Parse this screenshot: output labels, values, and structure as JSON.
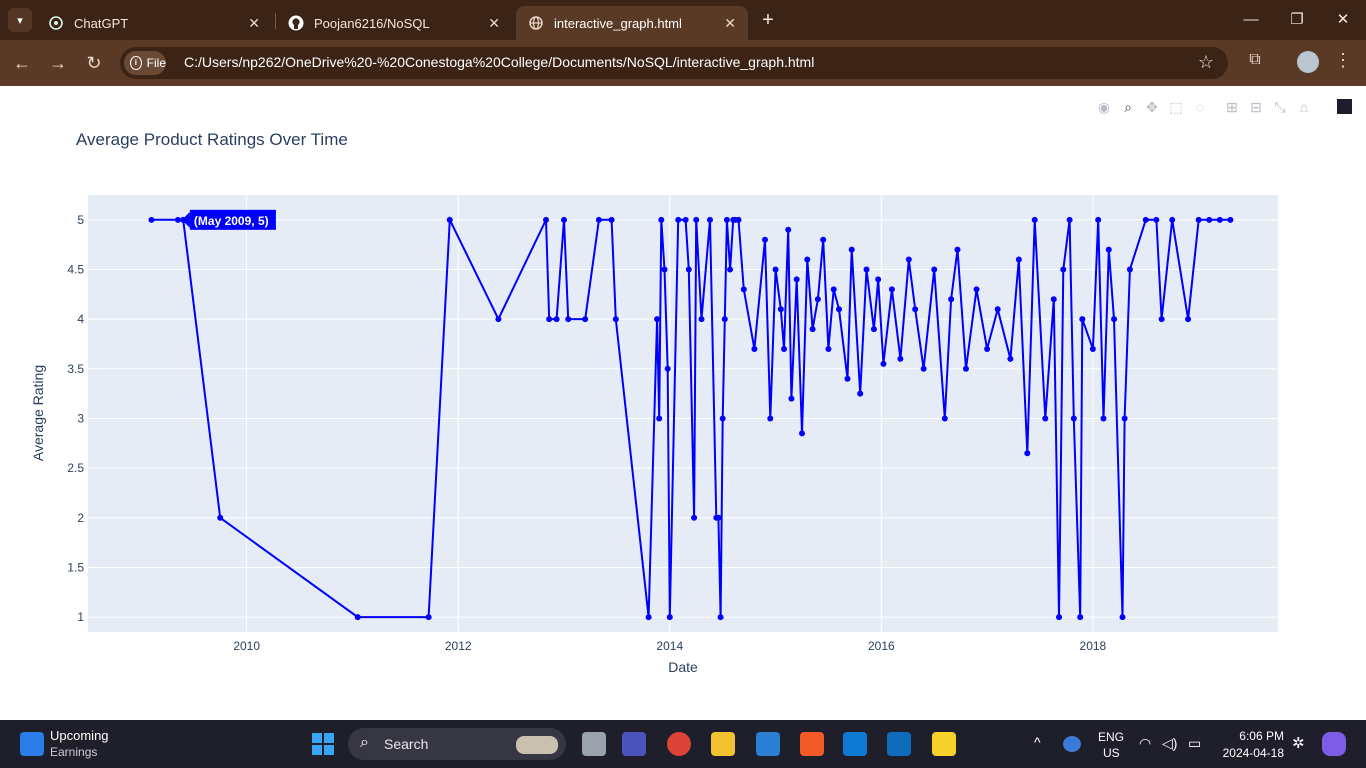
{
  "browser": {
    "tabs": [
      {
        "title": "ChatGPT",
        "icon": "chatgpt-icon"
      },
      {
        "title": "Poojan6216/NoSQL",
        "icon": "github-icon"
      },
      {
        "title": "interactive_graph.html",
        "icon": "globe-icon",
        "active": true
      }
    ],
    "address": {
      "chip": "File",
      "url": "C:/Users/np262/OneDrive%20-%20Conestoga%20College/Documents/NoSQL/interactive_graph.html"
    }
  },
  "taskbar": {
    "widget_title": "Upcoming",
    "widget_sub": "Earnings",
    "search_label": "Search",
    "lang_1": "ENG",
    "lang_2": "US",
    "time": "6:06 PM",
    "date": "2024-04-18"
  },
  "chart_data": {
    "type": "line",
    "title": "Average Product Ratings Over Time",
    "xlabel": "Date",
    "ylabel": "Average Rating",
    "x_ticks": [
      "2010",
      "2012",
      "2014",
      "2016",
      "2018"
    ],
    "y_ticks": [
      "1",
      "1.5",
      "2",
      "2.5",
      "3",
      "3.5",
      "4",
      "4.5",
      "5"
    ],
    "xlim": [
      2008.5,
      2019.75
    ],
    "ylim": [
      0.85,
      5.25
    ],
    "line_color": "#0000ff",
    "plot_bg": "#e5ecf6",
    "hover_label": "(May 2009, 5)",
    "series": [
      {
        "x": [
          2009.1,
          2009.35,
          2009.4,
          2009.75,
          2011.05,
          2011.72,
          2011.92,
          2012.38,
          2012.83,
          2012.86,
          2012.93,
          2013.0,
          2013.04,
          2013.2,
          2013.33,
          2013.45,
          2013.49,
          2013.8,
          2013.88,
          2013.9,
          2013.92,
          2013.95,
          2013.98,
          2014.0,
          2014.08,
          2014.15,
          2014.18,
          2014.23,
          2014.25,
          2014.3,
          2014.38,
          2014.44,
          2014.46,
          2014.48,
          2014.5,
          2014.52,
          2014.54,
          2014.57,
          2014.6,
          2014.62,
          2014.65,
          2014.7,
          2014.8,
          2014.9,
          2014.95,
          2015.0,
          2015.05,
          2015.08,
          2015.12,
          2015.15,
          2015.2,
          2015.25,
          2015.3,
          2015.35,
          2015.4,
          2015.45,
          2015.5,
          2015.55,
          2015.6,
          2015.68,
          2015.72,
          2015.8,
          2015.86,
          2015.93,
          2015.97,
          2016.02,
          2016.1,
          2016.18,
          2016.26,
          2016.32,
          2016.4,
          2016.5,
          2016.6,
          2016.66,
          2016.72,
          2016.8,
          2016.9,
          2017.0,
          2017.1,
          2017.22,
          2017.3,
          2017.38,
          2017.45,
          2017.55,
          2017.63,
          2017.68,
          2017.72,
          2017.78,
          2017.82,
          2017.88,
          2017.9,
          2018.0,
          2018.05,
          2018.1,
          2018.15,
          2018.2,
          2018.28,
          2018.3,
          2018.35,
          2018.5,
          2018.6,
          2018.65,
          2018.75,
          2018.9,
          2019.0,
          2019.1,
          2019.2,
          2019.3
        ],
        "y": [
          5,
          5,
          5,
          2,
          1,
          1,
          5,
          4,
          5,
          4,
          4,
          5,
          4,
          4,
          5,
          5,
          4,
          1,
          4,
          3,
          5,
          4.5,
          3.5,
          1,
          5,
          5,
          4.5,
          2,
          5,
          4,
          5,
          2,
          2,
          1,
          3,
          4,
          5,
          4.5,
          5,
          5,
          5,
          4.3,
          3.7,
          4.8,
          3,
          4.5,
          4.1,
          3.7,
          4.9,
          3.2,
          4.4,
          2.85,
          4.6,
          3.9,
          4.2,
          4.8,
          3.7,
          4.3,
          4.1,
          3.4,
          4.7,
          3.25,
          4.5,
          3.9,
          4.4,
          3.55,
          4.3,
          3.6,
          4.6,
          4.1,
          3.5,
          4.5,
          3.0,
          4.2,
          4.7,
          3.5,
          4.3,
          3.7,
          4.1,
          3.6,
          4.6,
          2.65,
          5,
          3.0,
          4.2,
          1,
          4.5,
          5,
          3.0,
          1,
          4.0,
          3.7,
          5,
          3.0,
          4.7,
          4.0,
          1,
          3.0,
          4.5,
          5,
          5,
          4.0,
          5,
          4.0,
          5,
          5,
          5,
          5
        ]
      }
    ]
  }
}
